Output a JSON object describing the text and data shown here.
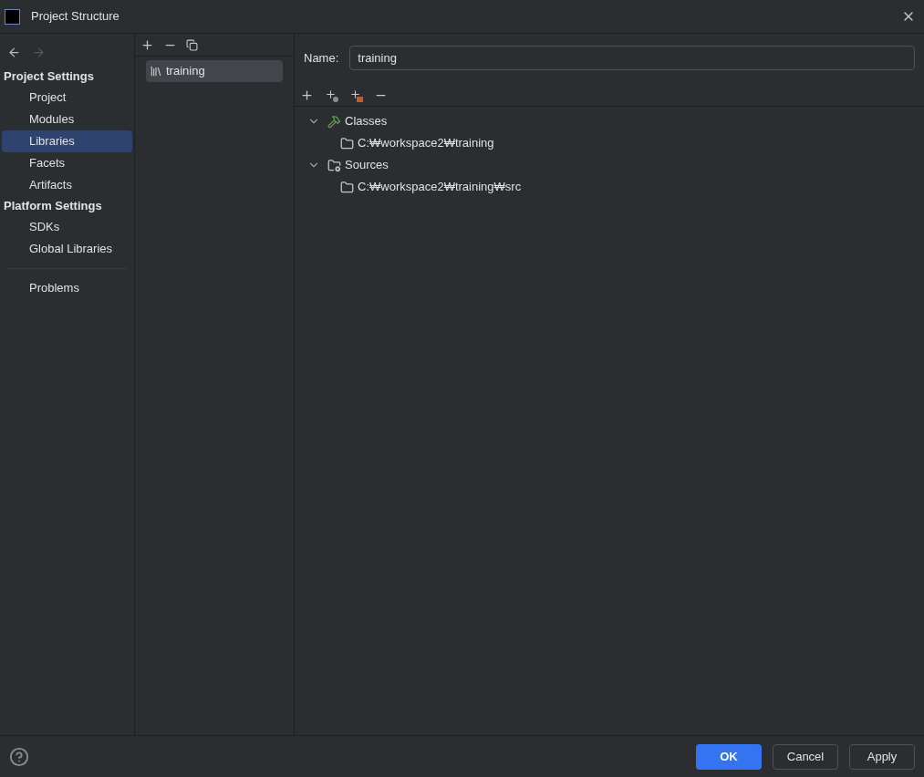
{
  "window": {
    "title": "Project Structure"
  },
  "nav": {
    "back_disabled": false,
    "forward_disabled": true
  },
  "sidebar": {
    "sections": [
      {
        "title": "Project Settings",
        "items": [
          {
            "label": "Project",
            "selected": false
          },
          {
            "label": "Modules",
            "selected": false
          },
          {
            "label": "Libraries",
            "selected": true
          },
          {
            "label": "Facets",
            "selected": false
          },
          {
            "label": "Artifacts",
            "selected": false
          }
        ]
      },
      {
        "title": "Platform Settings",
        "items": [
          {
            "label": "SDKs",
            "selected": false
          },
          {
            "label": "Global Libraries",
            "selected": false
          }
        ]
      }
    ],
    "bottom_items": [
      {
        "label": "Problems",
        "selected": false
      }
    ]
  },
  "libraries": [
    {
      "label": "training",
      "selected": true
    }
  ],
  "name_field": {
    "label": "Name:",
    "value": "training"
  },
  "tree": [
    {
      "label": "Classes",
      "kind": "classes",
      "expanded": true,
      "children": [
        {
          "label": "C:₩workspace2₩training",
          "kind": "folder"
        }
      ]
    },
    {
      "label": "Sources",
      "kind": "sources",
      "expanded": true,
      "children": [
        {
          "label": "C:₩workspace2₩training₩src",
          "kind": "folder"
        }
      ]
    }
  ],
  "buttons": [
    {
      "label": "OK",
      "kind": "primary"
    },
    {
      "label": "Cancel",
      "kind": "secondary"
    },
    {
      "label": "Apply",
      "kind": "secondary"
    }
  ]
}
